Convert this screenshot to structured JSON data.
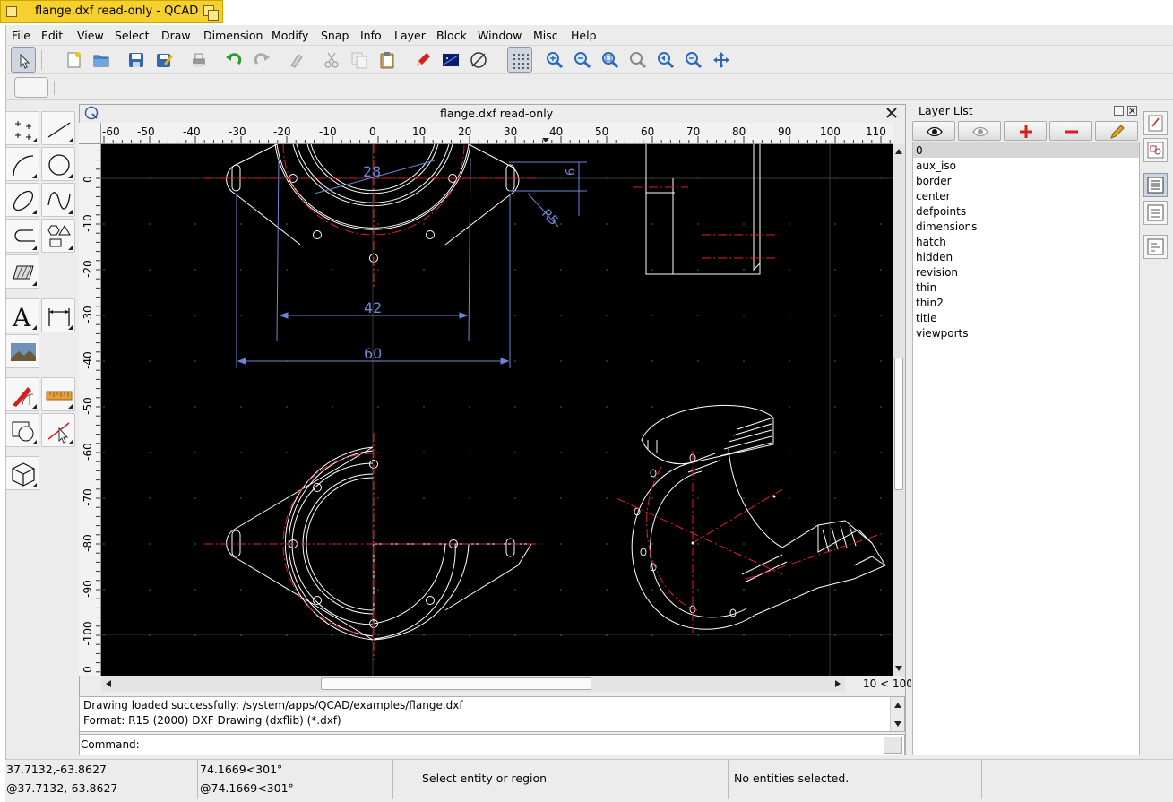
{
  "window": {
    "title": "flange.dxf read-only - QCAD"
  },
  "menubar": [
    "File",
    "Edit",
    "View",
    "Select",
    "Draw",
    "Dimension",
    "Modify",
    "Snap",
    "Info",
    "Layer",
    "Block",
    "Window",
    "Misc",
    "Help"
  ],
  "toolbar": {
    "icons": [
      "pointer-icon",
      "new-file-icon",
      "open-file-icon",
      "save-icon",
      "save-as-icon",
      "print-icon",
      "undo-icon",
      "redo-icon",
      "erase-icon",
      "cut-icon",
      "copy-icon",
      "paste-icon",
      "pen-icon",
      "background-icon",
      "draft-mode-icon",
      "grid-icon",
      "zoom-in-icon",
      "zoom-out-icon",
      "zoom-auto-icon",
      "zoom-window-icon",
      "zoom-previous-icon",
      "zoom-selection-icon",
      "pan-icon"
    ]
  },
  "drawing_window": {
    "title": "flange.dxf read-only",
    "ruler_x": [
      "-60",
      "-50",
      "-40",
      "-30",
      "-20",
      "-10",
      "0",
      "10",
      "20",
      "30",
      "40",
      "50",
      "60",
      "70",
      "80",
      "90",
      "100",
      "110"
    ],
    "ruler_y": [
      "0",
      "-10",
      "-20",
      "-30",
      "-40",
      "-50",
      "-60",
      "-70",
      "-80",
      "-90",
      "-100"
    ],
    "dimensions": {
      "d1": "28",
      "d2": "42",
      "d3": "60",
      "d4": "R5",
      "d5": "6"
    },
    "grid_info": "10 < 100"
  },
  "command_history": [
    "Drawing loaded successfully: /system/apps/QCAD/examples/flange.dxf",
    "Format: R15 (2000) DXF Drawing (dxflib) (*.dxf)"
  ],
  "command_prompt": "Command:",
  "layer_panel": {
    "title": "Layer List",
    "layers": [
      "0",
      "aux_iso",
      "border",
      "center",
      "defpoints",
      "dimensions",
      "hatch",
      "hidden",
      "revision",
      "thin",
      "thin2",
      "title",
      "viewports"
    ],
    "selected": "0"
  },
  "status": {
    "abs_coord": "37.7132,-63.8627",
    "rel_coord": "@37.7132,-63.8627",
    "polar": "74.1669<301°",
    "rel_polar": "@74.1669<301°",
    "prompt": "Select entity or region",
    "selection": "No entities selected."
  },
  "colors": {
    "title_accent": "#f6d02e",
    "canvas": "#000000",
    "dimension": "#6f86d6",
    "centerline": "#e0202a",
    "geometry": "#ffffff"
  }
}
